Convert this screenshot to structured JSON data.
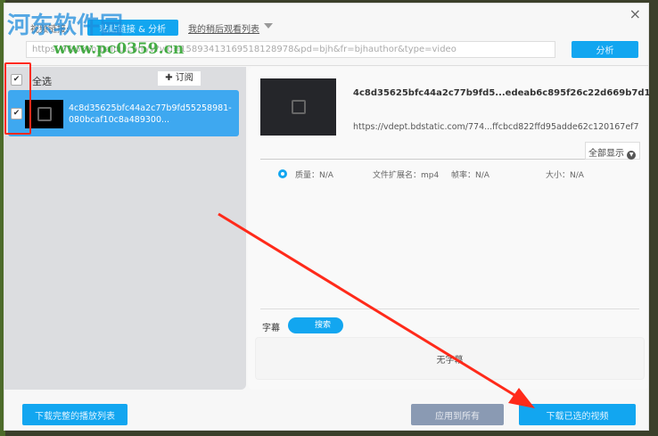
{
  "header": {
    "link_label": "视频链接:",
    "paste_button": "粘贴链接 & 分析",
    "watch_later": "我的稍后观看列表",
    "url_value": "https://haokan.baidu.com/v?vid=15893413169518128978&pd=bjh&fr=bjhauthor&type=video",
    "analyze_button": "分析",
    "close": "×"
  },
  "watermark": {
    "name": "河东软件园",
    "url": "www.pc0359.cn"
  },
  "list": {
    "select_all": "全选",
    "subscribe": "✚ 订阅",
    "items": [
      {
        "title": "4c8d35625bfc44a2c77b9fd55258981-080bcaf10c8a489300...",
        "checked": true
      }
    ]
  },
  "detail": {
    "title": "4c8d35625bfc44a2c77b9fd5...edeab6c895f26c22d669b7d1",
    "url": "https://vdept.bdstatic.com/774...ffcbcd822ffd95adde62c120167ef7",
    "show_all": "全部显示",
    "quality": "质量：N/A",
    "ext": "文件扩展名：mp4",
    "fps": "帧率：N/A",
    "size": "大小：N/A",
    "subtitle_label": "字幕",
    "search_button": "搜索",
    "no_subtitle": "无字幕"
  },
  "footer": {
    "download_playlist": "下载完整的播放列表",
    "apply_all": "应用到所有",
    "download_selected": "下载已选的视频"
  },
  "colors": {
    "accent": "#12a6f0",
    "selected_row": "#3ea8f0",
    "annotation": "#ff2a1a"
  }
}
